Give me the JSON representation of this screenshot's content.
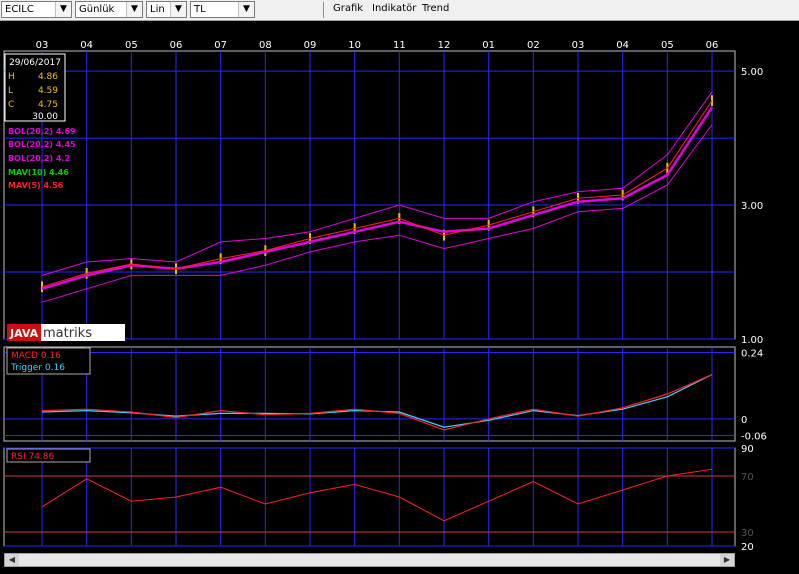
{
  "toolbar": {
    "symbol": "ECILC",
    "period": "Günlük",
    "scale": "Lin",
    "currency": "TL",
    "menu": [
      "Grafik",
      "Indikatör",
      "Trend"
    ]
  },
  "months": [
    "03",
    "04",
    "05",
    "06",
    "07",
    "08",
    "09",
    "10",
    "11",
    "12",
    "01",
    "02",
    "03",
    "04",
    "05",
    "06"
  ],
  "info": {
    "date": "29/06/2017",
    "h_label": "H",
    "h": "4.86",
    "l_label": "L",
    "l": "4.59",
    "c_label": "C",
    "c": "4.75",
    "vol": "30.00"
  },
  "legend": {
    "bol_upper": "BOL(20,2) 4.69",
    "bol_mid": "BOL(20,2) 4.45",
    "bol_lower": "BOL(20,2) 4.2",
    "mav10": "MAV(10) 4.46",
    "mav5": "MAV(5) 4.56"
  },
  "logo": {
    "java": "JAVA",
    "matriks": "matriks"
  },
  "macd_legend": {
    "macd": "MACD 0.16",
    "trigger": "Trigger 0.16"
  },
  "rsi_legend": {
    "rsi": "RSI 74.86"
  },
  "colors": {
    "grid": "#2828ff",
    "price": "#f0c000",
    "bol": "#e000e0",
    "mav10": "#00d000",
    "mav5": "#ff2020",
    "macd": "#ff2020",
    "trigger": "#40d0ff",
    "rsi": "#ff2020",
    "ref_line": "#c04040"
  },
  "chart_data": [
    {
      "type": "line",
      "title": "",
      "x": [
        "03",
        "04",
        "05",
        "06",
        "07",
        "08",
        "09",
        "10",
        "11",
        "12",
        "01",
        "02",
        "03",
        "04",
        "05",
        "06"
      ],
      "yticks": [
        "5.00",
        "3.00",
        "1.00"
      ],
      "ylim": [
        1,
        5.3
      ],
      "series": [
        {
          "name": "MAV(10)",
          "values": [
            1.75,
            1.95,
            2.1,
            2.05,
            2.15,
            2.3,
            2.45,
            2.6,
            2.75,
            2.6,
            2.65,
            2.85,
            3.05,
            3.1,
            3.45,
            4.46
          ]
        },
        {
          "name": "MAV(5)",
          "values": [
            1.78,
            1.98,
            2.12,
            2.05,
            2.2,
            2.32,
            2.5,
            2.65,
            2.8,
            2.55,
            2.7,
            2.9,
            3.1,
            3.15,
            3.55,
            4.56
          ]
        },
        {
          "name": "BOL(20,2)",
          "values": [
            1.95,
            2.15,
            2.2,
            2.15,
            2.45,
            2.5,
            2.6,
            2.8,
            3.0,
            2.8,
            2.8,
            3.05,
            3.2,
            3.25,
            3.75,
            4.69
          ]
        },
        {
          "name": "BOL(20,2)",
          "values": [
            1.55,
            1.75,
            1.95,
            1.95,
            1.95,
            2.1,
            2.3,
            2.45,
            2.55,
            2.35,
            2.5,
            2.65,
            2.9,
            2.95,
            3.3,
            4.2
          ]
        }
      ]
    },
    {
      "type": "line",
      "title": "",
      "x": [
        "03",
        "04",
        "05",
        "06",
        "07",
        "08",
        "09",
        "10",
        "11",
        "12",
        "01",
        "02",
        "03",
        "04",
        "05",
        "06"
      ],
      "yticks": [
        "0.24",
        "0",
        "-0.06"
      ],
      "ylim": [
        -0.08,
        0.26
      ],
      "series": [
        {
          "name": "MACD",
          "values": [
            0.03,
            0.035,
            0.025,
            0.005,
            0.03,
            0.015,
            0.02,
            0.035,
            0.02,
            -0.04,
            0.0,
            0.035,
            0.01,
            0.04,
            0.09,
            0.16
          ]
        },
        {
          "name": "Trigger",
          "values": [
            0.025,
            0.03,
            0.022,
            0.01,
            0.02,
            0.02,
            0.018,
            0.03,
            0.025,
            -0.03,
            -0.005,
            0.03,
            0.012,
            0.035,
            0.08,
            0.16
          ]
        }
      ]
    },
    {
      "type": "line",
      "title": "",
      "x": [
        "03",
        "04",
        "05",
        "06",
        "07",
        "08",
        "09",
        "10",
        "11",
        "12",
        "01",
        "02",
        "03",
        "04",
        "05",
        "06"
      ],
      "yticks": [
        "90",
        "70",
        "30",
        "20"
      ],
      "ylim": [
        20,
        90
      ],
      "series": [
        {
          "name": "RSI",
          "values": [
            48,
            68,
            52,
            55,
            62,
            50,
            58,
            64,
            55,
            38,
            52,
            66,
            50,
            60,
            70,
            74.86
          ]
        }
      ]
    }
  ]
}
